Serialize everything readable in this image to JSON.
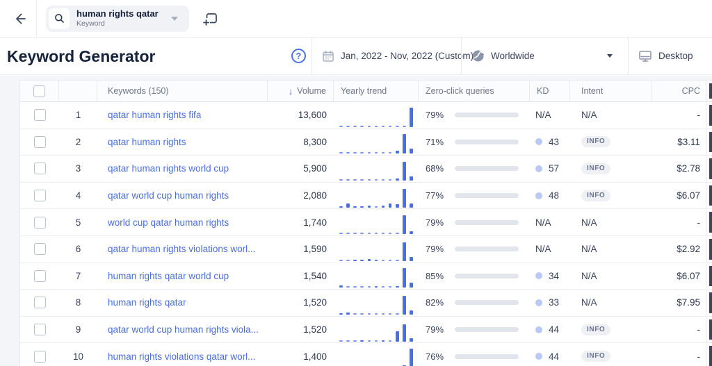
{
  "topbar": {
    "chip": {
      "keyword": "human rights qatar",
      "type_label": "Keyword"
    }
  },
  "header": {
    "title": "Keyword Generator",
    "help_glyph": "?",
    "date_range": "Jan, 2022 - Nov, 2022 (Custom)",
    "location": "Worldwide",
    "device": "Desktop"
  },
  "table": {
    "headers": {
      "keywords": "Keywords (150)",
      "volume": "Volume",
      "sort_arrow": "↓",
      "trend": "Yearly trend",
      "zero_click": "Zero-click queries",
      "kd": "KD",
      "intent": "Intent",
      "cpc": "CPC"
    },
    "rows": [
      {
        "num": "1",
        "keyword": "qatar human rights fifa",
        "volume": "13,600",
        "trend": [
          2,
          2,
          2,
          2,
          2,
          2,
          2,
          2,
          2,
          2,
          100
        ],
        "zero_click": "79%",
        "zero_click_pct": 79,
        "kd": "N/A",
        "intent": "N/A",
        "cpc": "-"
      },
      {
        "num": "2",
        "keyword": "qatar human rights",
        "volume": "8,300",
        "trend": [
          2,
          2,
          2,
          2,
          2,
          2,
          2,
          2,
          14,
          100,
          26
        ],
        "zero_click": "71%",
        "zero_click_pct": 71,
        "kd": "43",
        "intent": "INFO",
        "cpc": "$3.11"
      },
      {
        "num": "3",
        "keyword": "qatar human rights world cup",
        "volume": "5,900",
        "trend": [
          2,
          2,
          2,
          2,
          2,
          2,
          2,
          2,
          10,
          95,
          22
        ],
        "zero_click": "68%",
        "zero_click_pct": 68,
        "kd": "57",
        "intent": "INFO",
        "cpc": "$2.78"
      },
      {
        "num": "4",
        "keyword": "qatar world cup human rights",
        "volume": "2,080",
        "trend": [
          8,
          20,
          8,
          8,
          10,
          2,
          10,
          22,
          18,
          95,
          20
        ],
        "zero_click": "77%",
        "zero_click_pct": 77,
        "kd": "48",
        "intent": "INFO",
        "cpc": "$6.07"
      },
      {
        "num": "5",
        "keyword": "world cup qatar human rights",
        "volume": "1,740",
        "trend": [
          2,
          2,
          2,
          2,
          2,
          2,
          2,
          2,
          2,
          95,
          14
        ],
        "zero_click": "79%",
        "zero_click_pct": 79,
        "kd": "N/A",
        "intent": "N/A",
        "cpc": "-"
      },
      {
        "num": "6",
        "keyword": "qatar human rights violations worl...",
        "volume": "1,590",
        "trend": [
          2,
          2,
          8,
          4,
          10,
          6,
          2,
          2,
          2,
          95,
          20
        ],
        "zero_click": "79%",
        "zero_click_pct": 79,
        "kd": "N/A",
        "intent": "N/A",
        "cpc": "$2.92"
      },
      {
        "num": "7",
        "keyword": "human rights qatar world cup",
        "volume": "1,540",
        "trend": [
          10,
          2,
          2,
          2,
          2,
          8,
          2,
          2,
          6,
          100,
          25
        ],
        "zero_click": "85%",
        "zero_click_pct": 85,
        "kd": "34",
        "intent": "N/A",
        "cpc": "$6.07"
      },
      {
        "num": "8",
        "keyword": "human rights qatar",
        "volume": "1,520",
        "trend": [
          8,
          10,
          2,
          2,
          2,
          2,
          2,
          2,
          2,
          95,
          22
        ],
        "zero_click": "82%",
        "zero_click_pct": 82,
        "kd": "33",
        "intent": "N/A",
        "cpc": "$7.95"
      },
      {
        "num": "9",
        "keyword": "qatar world cup human rights viola...",
        "volume": "1,520",
        "trend": [
          2,
          2,
          2,
          8,
          2,
          2,
          8,
          2,
          55,
          90,
          18
        ],
        "zero_click": "79%",
        "zero_click_pct": 79,
        "kd": "44",
        "intent": "INFO",
        "cpc": "-"
      },
      {
        "num": "10",
        "keyword": "human rights violations qatar worl...",
        "volume": "1,400",
        "trend": [
          2,
          8,
          2,
          2,
          2,
          2,
          2,
          2,
          2,
          15,
          100
        ],
        "zero_click": "76%",
        "zero_click_pct": 76,
        "kd": "44",
        "intent": "INFO",
        "cpc": "-"
      }
    ]
  },
  "colors": {
    "accent": "#4a70e2",
    "link": "#4a6ee0",
    "bar_fill": "#4a72e0",
    "bar_track": "#e2e5ec",
    "kd_dot": "#bac8f5",
    "spark_bar": "#4a6fe3",
    "spark_dash": "#7d97ee"
  }
}
